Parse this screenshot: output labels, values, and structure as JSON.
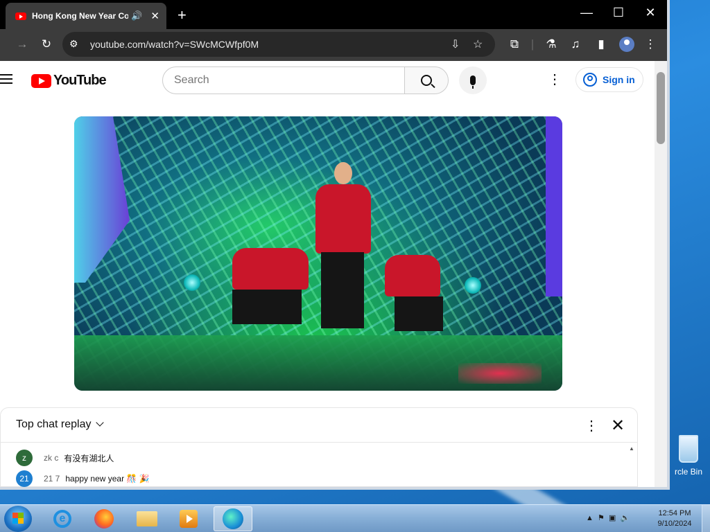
{
  "browser": {
    "tab_title": "Hong Kong New Year Cour",
    "tab_audio_icon": "speaker-icon",
    "url": "youtube.com/watch?v=SWcMCWfpf0M"
  },
  "youtube": {
    "logo_text": "YouTube",
    "search_placeholder": "Search",
    "signin_label": "Sign in"
  },
  "chat": {
    "header_label": "Top chat replay",
    "messages": [
      {
        "avatar": "z",
        "avatar_color": "#2e6b3a",
        "author": "zk c",
        "text": "有没有湖北人"
      },
      {
        "avatar": "21",
        "avatar_color": "#1e7fd0",
        "author": "21 7",
        "text": "happy new year 🎊 🎉"
      }
    ]
  },
  "desktop": {
    "recycle_bin_label": "rcle Bin"
  },
  "taskbar": {
    "time": "12:54 PM",
    "date": "9/10/2024"
  }
}
